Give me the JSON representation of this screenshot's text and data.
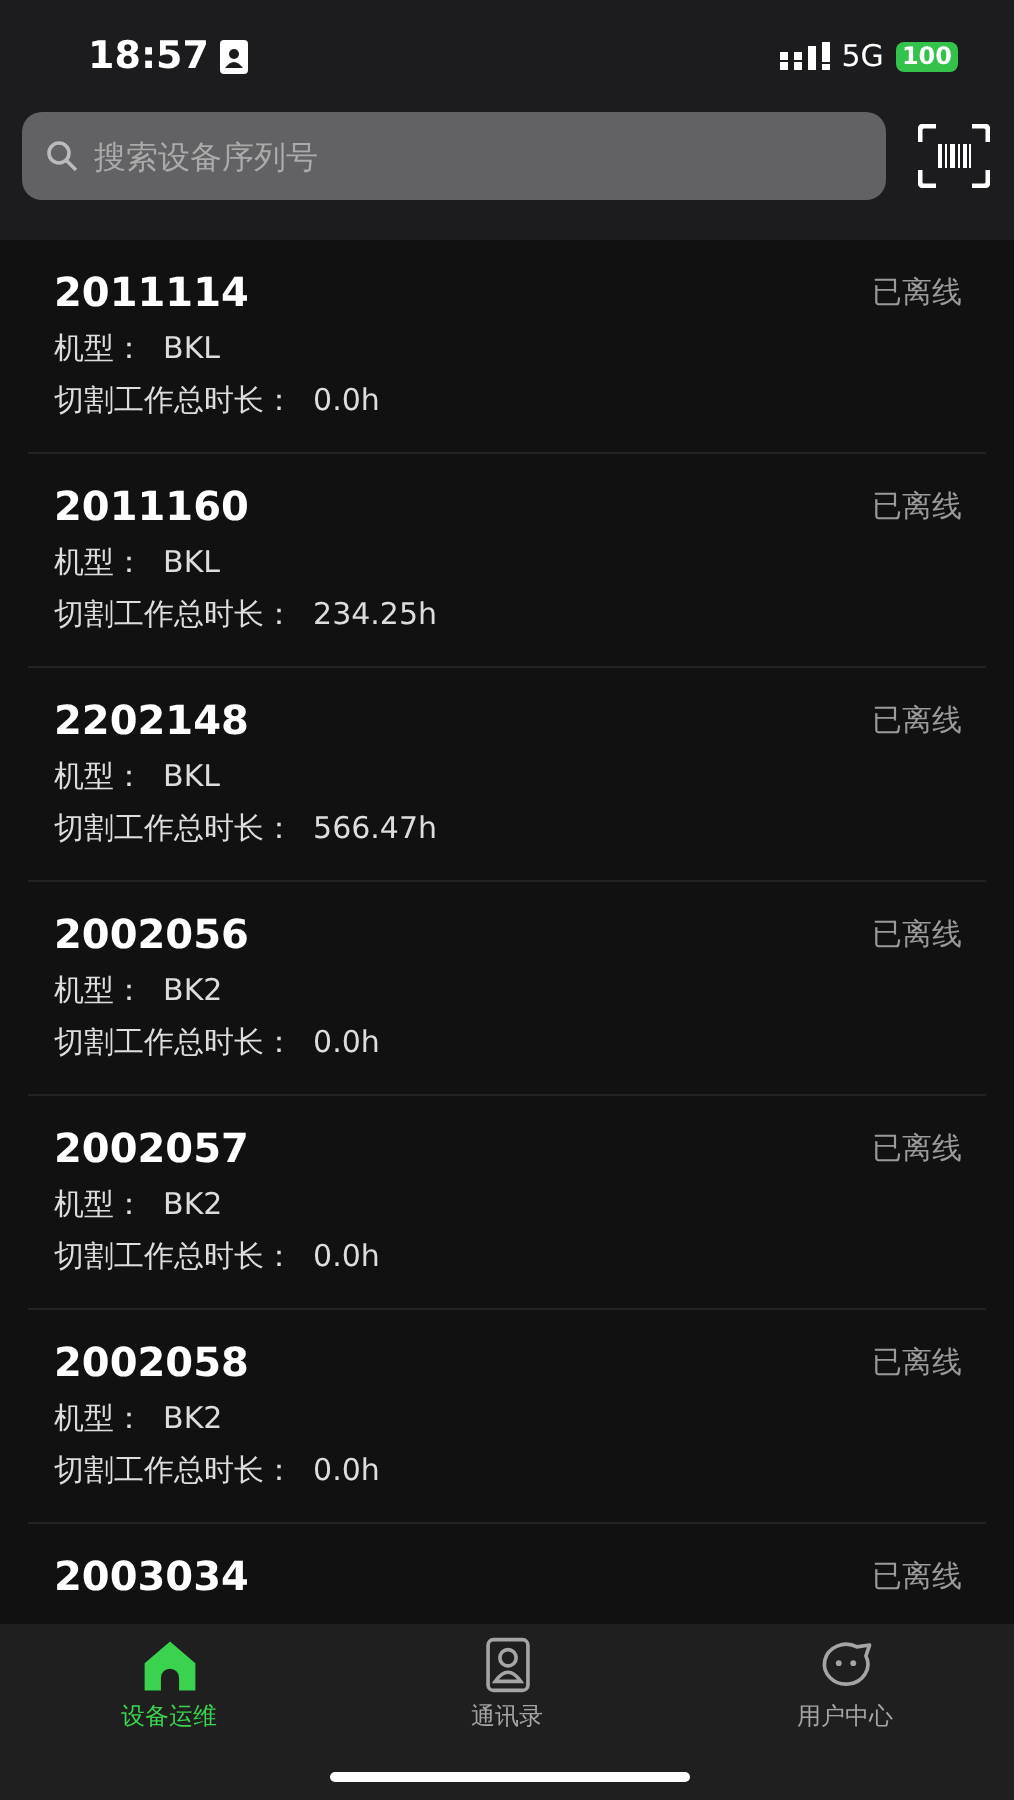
{
  "status_bar": {
    "time": "18:57",
    "network": "5G",
    "battery": "100"
  },
  "search": {
    "placeholder": "搜索设备序列号"
  },
  "devices": [
    {
      "serial": "2011114",
      "status": "已离线",
      "model": "机型：  BKL",
      "hours": "切割工作总时长：  0.0h"
    },
    {
      "serial": "2011160",
      "status": "已离线",
      "model": "机型：  BKL",
      "hours": "切割工作总时长：  234.25h"
    },
    {
      "serial": "2202148",
      "status": "已离线",
      "model": "机型：  BKL",
      "hours": "切割工作总时长：  566.47h"
    },
    {
      "serial": "2002056",
      "status": "已离线",
      "model": "机型：  BK2",
      "hours": "切割工作总时长：  0.0h"
    },
    {
      "serial": "2002057",
      "status": "已离线",
      "model": "机型：  BK2",
      "hours": "切割工作总时长：  0.0h"
    },
    {
      "serial": "2002058",
      "status": "已离线",
      "model": "机型：  BK2",
      "hours": "切割工作总时长：  0.0h"
    },
    {
      "serial": "2003034",
      "status": "已离线"
    }
  ],
  "tabs": [
    {
      "label": "设备运维",
      "kind": "home",
      "selected": true
    },
    {
      "label": "通讯录",
      "kind": "contacts",
      "selected": false
    },
    {
      "label": "用户中心",
      "kind": "user",
      "selected": false
    }
  ]
}
